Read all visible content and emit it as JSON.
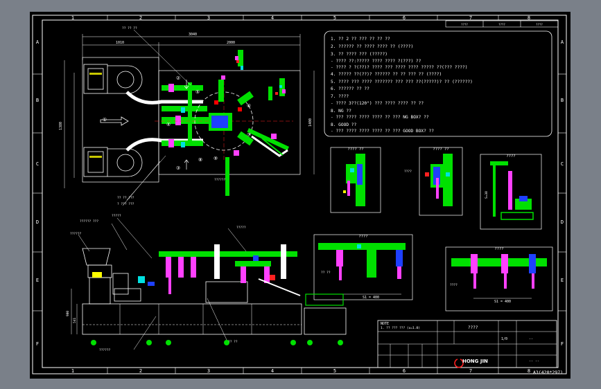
{
  "border": {
    "top_columns": [
      "1",
      "2",
      "3",
      "4",
      "5",
      "6",
      "7",
      "8"
    ],
    "bottom_columns": [
      "1",
      "2",
      "3",
      "4",
      "5",
      "6",
      "7",
      "8"
    ],
    "rows": [
      "A",
      "B",
      "C",
      "D",
      "E",
      "F"
    ]
  },
  "plan": {
    "overall_dim": "3040",
    "left_dim": "1010",
    "right_dim": "2000",
    "left_vertical_dim": "1380",
    "right_vertical_dim": "1400",
    "markers": [
      "①",
      "②",
      "③",
      "④",
      "⑤",
      "⑥",
      "⑦",
      "⑧",
      "⑨"
    ]
  },
  "notes": [
    "1. ?? 2 ?? ??? ?? ?? ??",
    "2. ?????? ?? ???? ???? ?? (????)",
    "3. ?? ???? ??? (?????)",
    "   - ???? ??:????? ???? ???? ?(???) ??",
    "   - ???? ? ?(??)? ???? ??? ???? ???? ????? ??(??? ????)",
    "4. ????? ??(??)? ?????? ?? ?? ??? ?? (????)",
    "5. ???? ??? ???? ??????? ??? ??? ??(?????)? ?? (??????)",
    "6. ?????? ?? ??",
    "7. ????",
    "   - ???? 3??(120°) ??? ???? ???? ?? ??",
    "8. NG ??",
    "   - ??? ???? ???? ???? ?? ??? NG BOX? ??",
    "8. GOOD ??",
    "   - ??? ???? ???? ???? ?? ??? GOOD BOX? ??"
  ],
  "detail_views": [
    "???? ??",
    "???? ??",
    "????",
    "????",
    "????"
  ],
  "dims": {
    "detail_dim_1": "S1 = 400",
    "detail_dim_2": "S1 = 400",
    "s_dim": "S=38",
    "elev_height_1": "900",
    "elev_height_2": "541"
  },
  "callouts": [
    "?? ?? ??",
    "?? ?? ???",
    "? ??? ???",
    "?????? ???",
    "?????",
    "??????",
    "?????",
    "????",
    "?? ??",
    "?? ??",
    "????",
    "??????",
    "??????"
  ],
  "title_block": {
    "note_label": "NOTE",
    "note_line": "1. ?? ??? ??? (u=1.0)",
    "logo": "HONG JIN",
    "sheet_size": "A3(420*297)",
    "drawing_name": "????",
    "dwg_no": "-- --",
    "scale": "1/0",
    "rev": "--"
  },
  "top_cells": [
    "????",
    "????",
    "????"
  ]
}
